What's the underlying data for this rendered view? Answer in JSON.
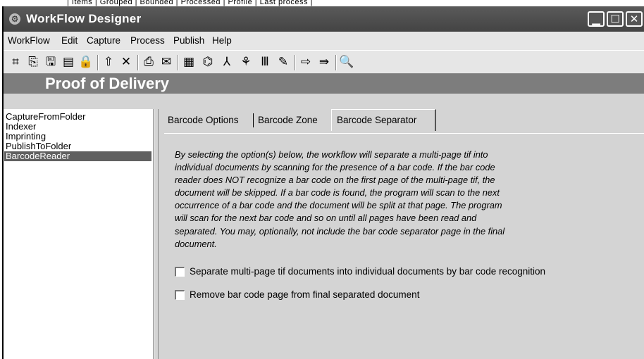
{
  "clipped_header": "| Items | Grouped | Bounded | Processed | Profile | Last process |",
  "window": {
    "title": "WorkFlow Designer",
    "app_icon": "gear-icon"
  },
  "menu": [
    "WorkFlow",
    "Edit",
    "Capture",
    "Process",
    "Publish",
    "Help"
  ],
  "toolbar_icons": [
    {
      "name": "new-workflow-icon",
      "glyph": "⌗"
    },
    {
      "name": "copy-icon",
      "glyph": "⎘"
    },
    {
      "name": "save-icon",
      "glyph": "🖫"
    },
    {
      "name": "save-as-icon",
      "glyph": "▤"
    },
    {
      "name": "lock-icon",
      "glyph": "🔒"
    },
    {
      "name": "move-up-icon",
      "glyph": "⇧"
    },
    {
      "name": "delete-icon",
      "glyph": "✕"
    },
    {
      "name": "capture-icon",
      "glyph": "⎙"
    },
    {
      "name": "email-icon",
      "glyph": "✉"
    },
    {
      "name": "index-icon",
      "glyph": "▦"
    },
    {
      "name": "ocr-icon",
      "glyph": "⌬"
    },
    {
      "name": "pdf-icon",
      "glyph": "⅄"
    },
    {
      "name": "meta-icon",
      "glyph": "⚘"
    },
    {
      "name": "barcode-icon",
      "glyph": "Ⅲ"
    },
    {
      "name": "sign-icon",
      "glyph": "✎"
    },
    {
      "name": "export-icon",
      "glyph": "⇨"
    },
    {
      "name": "publish-icon",
      "glyph": "⇛"
    },
    {
      "name": "preview-icon",
      "glyph": "🔍"
    }
  ],
  "workflow_name": "Proof of Delivery",
  "steps": [
    "CaptureFromFolder",
    "Indexer",
    "Imprinting",
    "PublishToFolder",
    "BarcodeReader"
  ],
  "selected_step": "BarcodeReader",
  "tabs": [
    "Barcode Options",
    "Barcode Zone",
    "Barcode Separator"
  ],
  "active_tab": "Barcode Separator",
  "description": "By selecting the option(s) below, the workflow will separate a multi-page tif into\nindividual documents by scanning for the presence of a bar code.  If the bar code\nreader does NOT recognize a bar code on the first page of the multi-page tif, the\ndocument will be skipped.  If a bar code is found, the program will scan to the next\noccurrence of a bar code and the document will be split at that page.  The program\nwill scan for the next bar code and so on until all pages have been read and\nseparated.  You may, optionally, not include the bar code separator page in the final\ndocument.",
  "options": [
    {
      "label": "Separate multi-page tif documents into individual documents by bar code recognition",
      "checked": false
    },
    {
      "label": "Remove bar code page from final separated document",
      "checked": false
    }
  ]
}
